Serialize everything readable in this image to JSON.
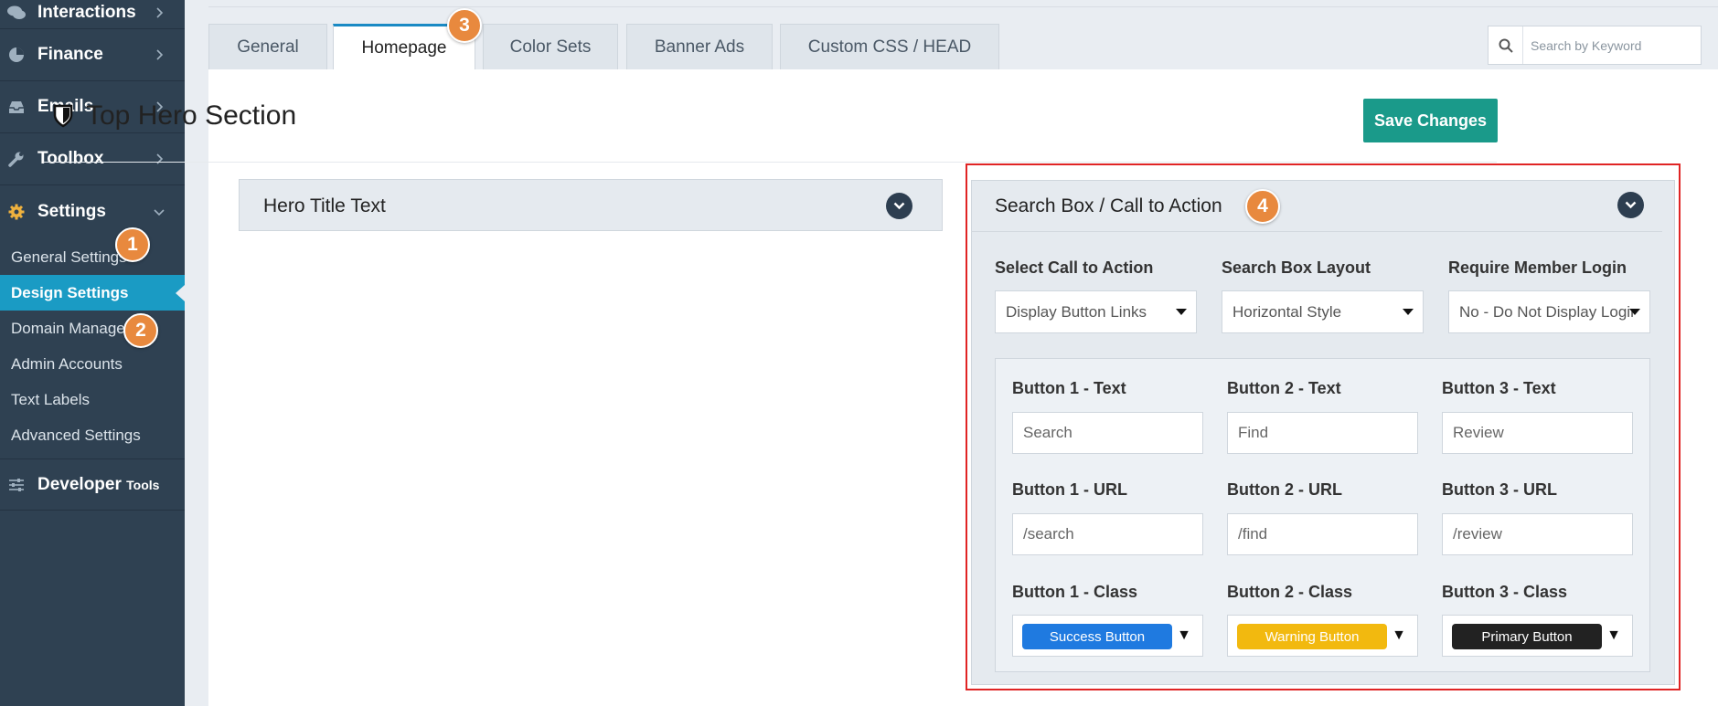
{
  "sidebar": {
    "items": [
      {
        "label": "Interactions",
        "icon": "comments-icon"
      },
      {
        "label": "Finance",
        "icon": "pie-chart-icon"
      },
      {
        "label": "Emails",
        "icon": "inbox-icon"
      },
      {
        "label": "Toolbox",
        "icon": "wrench-icon"
      },
      {
        "label": "Settings",
        "icon": "gear-icon"
      }
    ],
    "settings_sub": [
      "General Settings",
      "Design Settings",
      "Domain Manager",
      "Admin Accounts",
      "Text Labels",
      "Advanced Settings"
    ],
    "developer": {
      "label": "Developer",
      "label_small": "Tools",
      "icon": "sliders-icon"
    }
  },
  "badges": {
    "b1": "1",
    "b2": "2",
    "b3": "3",
    "b4": "4"
  },
  "tabs": [
    "General",
    "Homepage",
    "Color Sets",
    "Banner Ads",
    "Custom CSS / HEAD"
  ],
  "active_tab": "Homepage",
  "search": {
    "placeholder": "Search by Keyword"
  },
  "page": {
    "title": "Top Hero Section",
    "save_label": "Save Changes"
  },
  "hero_title_panel": {
    "title": "Hero Title Text"
  },
  "cta_panel": {
    "title": "Search Box / Call to Action",
    "fields": [
      {
        "label": "Select Call to Action",
        "value": "Display Button Links"
      },
      {
        "label": "Search Box Layout",
        "value": "Horizontal Style"
      },
      {
        "label": "Require Member Login",
        "value": "No - Do Not Display Login"
      }
    ],
    "buttons": [
      {
        "text_label": "Button 1 - Text",
        "text_value": "Search",
        "url_label": "Button 1 - URL",
        "url_value": "/search",
        "class_label": "Button 1 - Class",
        "class_value": "Success Button",
        "class_color": "#1f7ae0"
      },
      {
        "text_label": "Button 2 - Text",
        "text_value": "Find",
        "url_label": "Button 2 - URL",
        "url_value": "/find",
        "class_label": "Button 2 - Class",
        "class_value": "Warning Button",
        "class_color": "#f2b90f"
      },
      {
        "text_label": "Button 3 - Text",
        "text_value": "Review",
        "url_label": "Button 3 - URL",
        "url_value": "/review",
        "class_label": "Button 3 - Class",
        "class_value": "Primary Button",
        "class_color": "#222222"
      }
    ]
  },
  "colors": {
    "sidebar_bg": "#2f4152",
    "active_sub": "#1a9bc4",
    "save_button": "#1a9a8a",
    "badge": "#e8893e",
    "highlight_border": "#e02424"
  }
}
